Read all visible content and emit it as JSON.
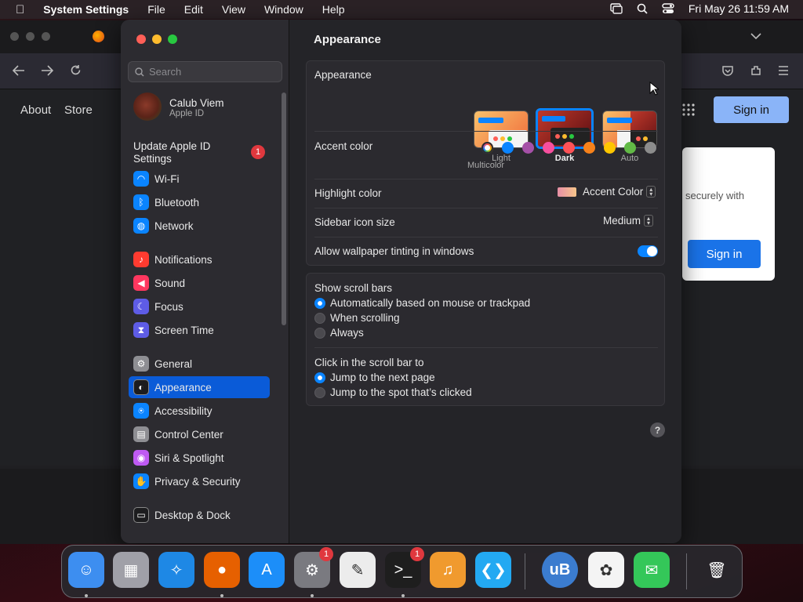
{
  "menubar": {
    "app_name": "System Settings",
    "items": [
      "File",
      "Edit",
      "View",
      "Window",
      "Help"
    ],
    "clock": "Fri May 26  11:59 AM"
  },
  "browser": {
    "nav_links": [
      "About",
      "Store"
    ],
    "signin_top": "Sign in",
    "card_text": "securely with",
    "signin_card": "Sign in"
  },
  "sidebar": {
    "search_placeholder": "Search",
    "user": {
      "name": "Calub Viem",
      "subtitle": "Apple ID"
    },
    "update": {
      "label_line1": "Update Apple ID",
      "label_line2": "Settings",
      "badge": "1"
    },
    "items": [
      {
        "label": "Wi-Fi",
        "icon": "wifi-icon",
        "color": "#0a84ff"
      },
      {
        "label": "Bluetooth",
        "icon": "bluetooth-icon",
        "color": "#0a84ff"
      },
      {
        "label": "Network",
        "icon": "globe-icon",
        "color": "#0a84ff"
      },
      {
        "label": "Notifications",
        "icon": "bell-icon",
        "color": "#ff3b30"
      },
      {
        "label": "Sound",
        "icon": "speaker-icon",
        "color": "#ff375f"
      },
      {
        "label": "Focus",
        "icon": "moon-icon",
        "color": "#5e5ce6"
      },
      {
        "label": "Screen Time",
        "icon": "hourglass-icon",
        "color": "#5e5ce6"
      },
      {
        "label": "General",
        "icon": "gear-icon",
        "color": "#8e8e93"
      },
      {
        "label": "Appearance",
        "icon": "appearance-icon",
        "color": "#1c1c1e"
      },
      {
        "label": "Accessibility",
        "icon": "accessibility-icon",
        "color": "#0a84ff"
      },
      {
        "label": "Control Center",
        "icon": "control-center-icon",
        "color": "#8e8e93"
      },
      {
        "label": "Siri & Spotlight",
        "icon": "siri-icon",
        "color": "#bf5af2"
      },
      {
        "label": "Privacy & Security",
        "icon": "hand-icon",
        "color": "#0a84ff"
      },
      {
        "label": "Desktop & Dock",
        "icon": "dock-icon",
        "color": "#1c1c1e"
      }
    ],
    "selected": "Appearance"
  },
  "main": {
    "title": "Appearance",
    "appearance_label": "Appearance",
    "themes": [
      {
        "label": "Light",
        "selected": false
      },
      {
        "label": "Dark",
        "selected": true
      },
      {
        "label": "Auto",
        "selected": false
      }
    ],
    "accent_label": "Accent color",
    "accent_caption": "Multicolor",
    "accent_colors": [
      "multicolor",
      "#0a84ff",
      "#a550a7",
      "#f74f9e",
      "#ff5257",
      "#f7821b",
      "#ffc600",
      "#62ba46",
      "#8c8c8c"
    ],
    "highlight_label": "Highlight color",
    "highlight_value": "Accent Color",
    "sidebar_icon_label": "Sidebar icon size",
    "sidebar_icon_value": "Medium",
    "wallpaper_tint_label": "Allow wallpaper tinting in windows",
    "wallpaper_tint_on": true,
    "scrollbars_label": "Show scroll bars",
    "scrollbars_options": [
      {
        "label": "Automatically based on mouse or trackpad",
        "selected": true
      },
      {
        "label": "When scrolling",
        "selected": false
      },
      {
        "label": "Always",
        "selected": false
      }
    ],
    "click_label": "Click in the scroll bar to",
    "click_options": [
      {
        "label": "Jump to the next page",
        "selected": true
      },
      {
        "label": "Jump to the spot that’s clicked",
        "selected": false
      }
    ],
    "help": "?"
  },
  "dock": {
    "apps": [
      {
        "name": "Finder",
        "icon": "finder-icon",
        "color": "#3d8ef0",
        "running": true
      },
      {
        "name": "Launchpad",
        "icon": "launchpad-icon",
        "color": "#a0a0a8",
        "running": false
      },
      {
        "name": "Safari",
        "icon": "safari-icon",
        "color": "#1e88e5",
        "running": false
      },
      {
        "name": "Firefox",
        "icon": "firefox-icon",
        "color": "#e66000",
        "running": true
      },
      {
        "name": "App Store",
        "icon": "app-store-icon",
        "color": "#1c8ef9",
        "running": false
      },
      {
        "name": "System Settings",
        "icon": "settings-icon",
        "color": "#7a7a80",
        "running": true,
        "badge": "1"
      },
      {
        "name": "TextEdit",
        "icon": "textedit-icon",
        "color": "#ececec",
        "running": false
      },
      {
        "name": "Terminal",
        "icon": "terminal-icon",
        "color": "#1e1e1e",
        "running": true,
        "badge": "1"
      },
      {
        "name": "GarageBand",
        "icon": "garageband-icon",
        "color": "#f09a2e",
        "running": false
      },
      {
        "name": "VS Code",
        "icon": "vscode-icon",
        "color": "#23a9f2",
        "running": false
      },
      {
        "name": "uBlock",
        "icon": "ublock-icon",
        "color": "#3b7ccf",
        "running": false
      },
      {
        "name": "Photos",
        "icon": "photos-icon",
        "color": "#f4f4f4",
        "running": false
      },
      {
        "name": "Messages",
        "icon": "messages-icon",
        "color": "#34c759",
        "running": false
      },
      {
        "name": "Trash",
        "icon": "trash-icon",
        "color": "#8a8a90",
        "running": false
      }
    ],
    "ublock_text": "uB"
  }
}
